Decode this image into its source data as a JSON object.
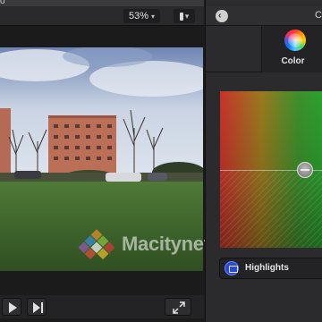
{
  "window": {
    "title_fragment": "o"
  },
  "viewer": {
    "zoom": "53%",
    "zoom_chevron": "▾",
    "view_options_chevron": "▾",
    "watermark": "Macitynet.it"
  },
  "transport": {
    "play_icon": "play-icon",
    "next_icon": "next-frame-icon",
    "fullscreen_icon": "fullscreen-icon"
  },
  "inspector": {
    "title_fragment": "C",
    "back_glyph": "‹",
    "tabs": [
      {
        "label": "Color",
        "icon": "color-wheel-icon",
        "selected": true
      }
    ],
    "color_board": {
      "mode": "Highlights",
      "gradient_left": "#c8322b",
      "gradient_right": "#2aa12f"
    }
  },
  "colors": {
    "background": "#1c1c1d",
    "panel": "#2b2b2d",
    "accent": "#2a4ad9"
  }
}
